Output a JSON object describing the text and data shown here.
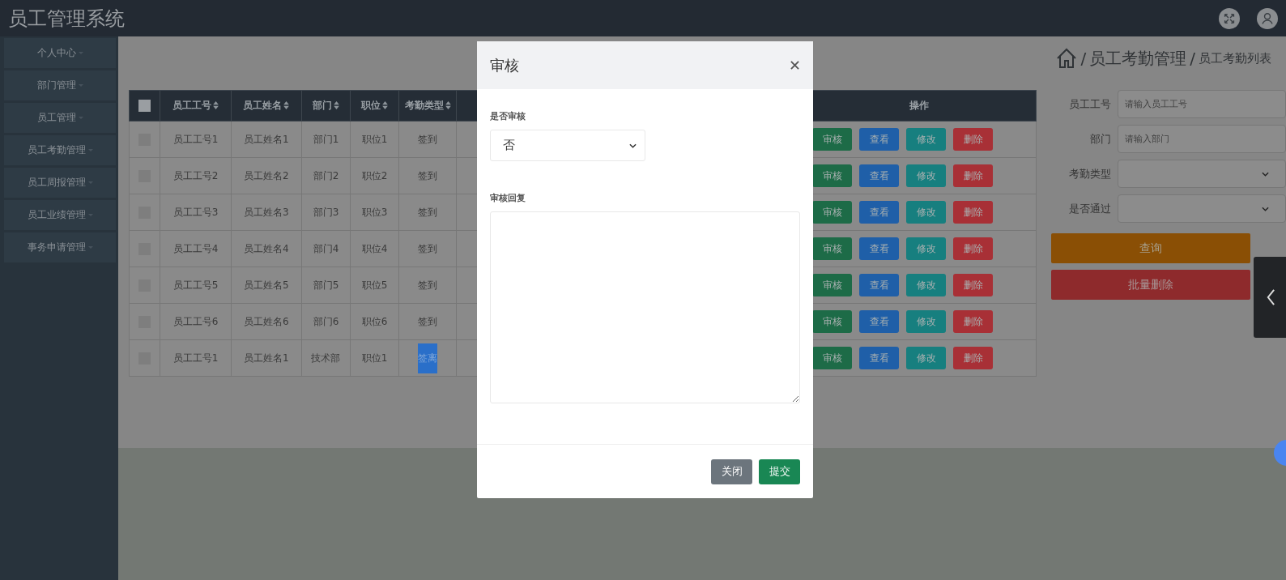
{
  "app_title": "员工管理系统",
  "sidebar": {
    "items": [
      {
        "label": "个人中心"
      },
      {
        "label": "部门管理"
      },
      {
        "label": "员工管理"
      },
      {
        "label": "员工考勤管理"
      },
      {
        "label": "员工周报管理"
      },
      {
        "label": "员工业绩管理"
      },
      {
        "label": "事务申请管理"
      }
    ]
  },
  "breadcrumb": {
    "items": [
      {
        "separator": "/",
        "label": "员工考勤管理"
      },
      {
        "separator": "/",
        "label": "员工考勤列表"
      }
    ]
  },
  "table": {
    "select_all_checked": false,
    "columns": [
      {
        "label": "员工工号",
        "sortable": true
      },
      {
        "label": "员工姓名",
        "sortable": true
      },
      {
        "label": "部门",
        "sortable": true
      },
      {
        "label": "职位",
        "sortable": true
      },
      {
        "label": "考勤类型",
        "sortable": true
      }
    ],
    "action_column": "操作",
    "rows": [
      {
        "checked": false,
        "cells": [
          "员工工号1",
          "员工姓名1",
          "部门1",
          "职位1",
          "签到"
        ],
        "type_text_selected": false,
        "actions": [
          "审核",
          "查看",
          "修改",
          "删除"
        ]
      },
      {
        "checked": false,
        "cells": [
          "员工工号2",
          "员工姓名2",
          "部门2",
          "职位2",
          "签到"
        ],
        "type_text_selected": false,
        "actions": [
          "审核",
          "查看",
          "修改",
          "删除"
        ]
      },
      {
        "checked": false,
        "cells": [
          "员工工号3",
          "员工姓名3",
          "部门3",
          "职位3",
          "签到"
        ],
        "type_text_selected": false,
        "actions": [
          "审核",
          "查看",
          "修改",
          "删除"
        ]
      },
      {
        "checked": false,
        "cells": [
          "员工工号4",
          "员工姓名4",
          "部门4",
          "职位4",
          "签到"
        ],
        "type_text_selected": false,
        "actions": [
          "审核",
          "查看",
          "修改",
          "删除"
        ]
      },
      {
        "checked": false,
        "cells": [
          "员工工号5",
          "员工姓名5",
          "部门5",
          "职位5",
          "签到"
        ],
        "type_text_selected": false,
        "actions": [
          "审核",
          "查看",
          "修改",
          "删除"
        ]
      },
      {
        "checked": false,
        "cells": [
          "员工工号6",
          "员工姓名6",
          "部门6",
          "职位6",
          "签到"
        ],
        "type_text_selected": false,
        "actions": [
          "审核",
          "查看",
          "修改",
          "删除"
        ]
      },
      {
        "checked": false,
        "cells": [
          "员工工号1",
          "员工姓名1",
          "技术部",
          "职位1",
          "签离"
        ],
        "type_text_selected": true,
        "actions": [
          "审核",
          "查看",
          "修改",
          "删除"
        ]
      }
    ]
  },
  "search_panel": {
    "fields": [
      {
        "kind": "input",
        "label": "员工工号",
        "placeholder": "请输入员工工号"
      },
      {
        "kind": "input",
        "label": "部门",
        "placeholder": "请输入部门"
      },
      {
        "kind": "select",
        "label": "考勤类型"
      },
      {
        "kind": "select",
        "label": "是否通过"
      }
    ],
    "buttons": [
      {
        "kind": "query",
        "label": "查询"
      },
      {
        "kind": "danger",
        "label": "批量删除"
      }
    ]
  },
  "modal": {
    "title": "审核",
    "fields": [
      {
        "kind": "select",
        "label": "是否审核",
        "value": "否"
      },
      {
        "kind": "textarea",
        "label": "审核回复"
      }
    ],
    "buttons": [
      {
        "kind": "secondary",
        "label": "关闭"
      },
      {
        "kind": "primary",
        "label": "提交"
      }
    ]
  }
}
